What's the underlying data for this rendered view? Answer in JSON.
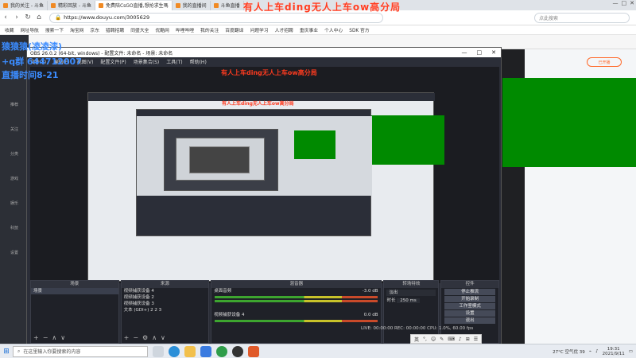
{
  "browser": {
    "tabs": [
      {
        "label": "我的关注 - 斗鱼",
        "active": false
      },
      {
        "label": "精彩回放 - 斗鱼",
        "active": false
      },
      {
        "label": "免费陪CsGO直播,想抢求生嗎",
        "active": true
      },
      {
        "label": "我的直播间",
        "active": false
      },
      {
        "label": "斗鱼直播",
        "active": false
      }
    ],
    "window_controls": [
      "—",
      "□",
      "✕"
    ],
    "url": "https://www.douyu.com/3005629",
    "search_placeholder": "点此搜索",
    "bookmarks": [
      "收藏",
      "网址导航",
      "搜索一下",
      "淘宝网",
      "京东",
      "猎聘招聘",
      "同盛大全",
      "优酷网",
      "哔哩哔哩",
      "我的关注",
      "百度翻译",
      "问题学习",
      "人才招聘",
      "重庆事业",
      "个人中心",
      "SDK 官方"
    ]
  },
  "douyu": {
    "sidebar_items": [
      "推荐",
      "关注",
      "分类",
      "游戏",
      "娱乐",
      "科技",
      "设置"
    ],
    "profile_button": "已开播"
  },
  "overlay": {
    "title": "有人上车ding无人上车ow高分局",
    "nickname": "猿猿猿(凌凌漆)",
    "qq": "+q群 644712007",
    "stream_time": "直播时间8-21"
  },
  "obs": {
    "title": "OBS 26.0.2 (64-bit, windows) - 配置文件: 未命名 - 场景: 未命名",
    "menu": [
      "文件(F)",
      "编辑(E)",
      "视图(V)",
      "配置文件(P)",
      "场景集合(S)",
      "工具(T)",
      "帮助(H)"
    ],
    "docks": {
      "scenes": {
        "header": "场景",
        "items": [
          "场景"
        ]
      },
      "sources": {
        "header": "来源",
        "items": [
          "视频捕获设备 4",
          "视频捕获设备 2",
          "视频捕获设备 3",
          "文本 (GDI+) 2 2 3"
        ]
      },
      "mixer": {
        "header": "混音器",
        "channels": [
          {
            "name": "桌面音频",
            "level": "-3.0 dB"
          },
          {
            "name": "视频捕获设备 4",
            "level": "0.0 dB"
          }
        ]
      },
      "transitions": {
        "header": "转场特效",
        "type": "淡出",
        "duration_label": "时长",
        "duration": "250 ms"
      },
      "controls": {
        "header": "控件",
        "buttons": [
          "停止推流",
          "开始录制",
          "工作室模式",
          "设置",
          "退出"
        ]
      }
    },
    "status": "LIVE: 00:00:00   REC: 00:00:00   CPU: 1.0%, 60.00 fps"
  },
  "taskbar": {
    "search_placeholder": "在这里输入你要搜索的内容",
    "weather": "27°C 空气优 39",
    "time": "19:31",
    "date": "2021/9/11",
    "ime": [
      "英",
      "°,",
      "☺",
      "✎",
      "⌨",
      "♪",
      "⊞",
      "☰"
    ]
  }
}
